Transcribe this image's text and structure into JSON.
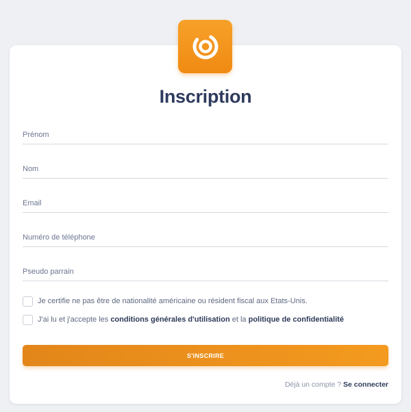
{
  "brand": {
    "logo_icon": "ring-logo-icon",
    "accent": "#f39a1f"
  },
  "page": {
    "title": "Inscription"
  },
  "form": {
    "fields": [
      {
        "placeholder": "Prénom",
        "value": ""
      },
      {
        "placeholder": "Nom",
        "value": ""
      },
      {
        "placeholder": "Email",
        "value": ""
      },
      {
        "placeholder": "Numéro de téléphone",
        "value": ""
      },
      {
        "placeholder": "Pseudo parrain",
        "value": ""
      }
    ],
    "checkbox_us": {
      "label": "Je certifie ne pas être de nationalité américaine ou résident fiscal aux Etats-Unis."
    },
    "checkbox_terms": {
      "prefix": "J'ai lu et j'accepte les ",
      "terms_link": "conditions générales d'utilisation",
      "middle": " et la ",
      "privacy_link": "politique de confidentialité"
    },
    "submit_label": "S'INSCRIRE"
  },
  "footer": {
    "prompt": "Déjà un compte ? ",
    "login_link": "Se connecter"
  }
}
